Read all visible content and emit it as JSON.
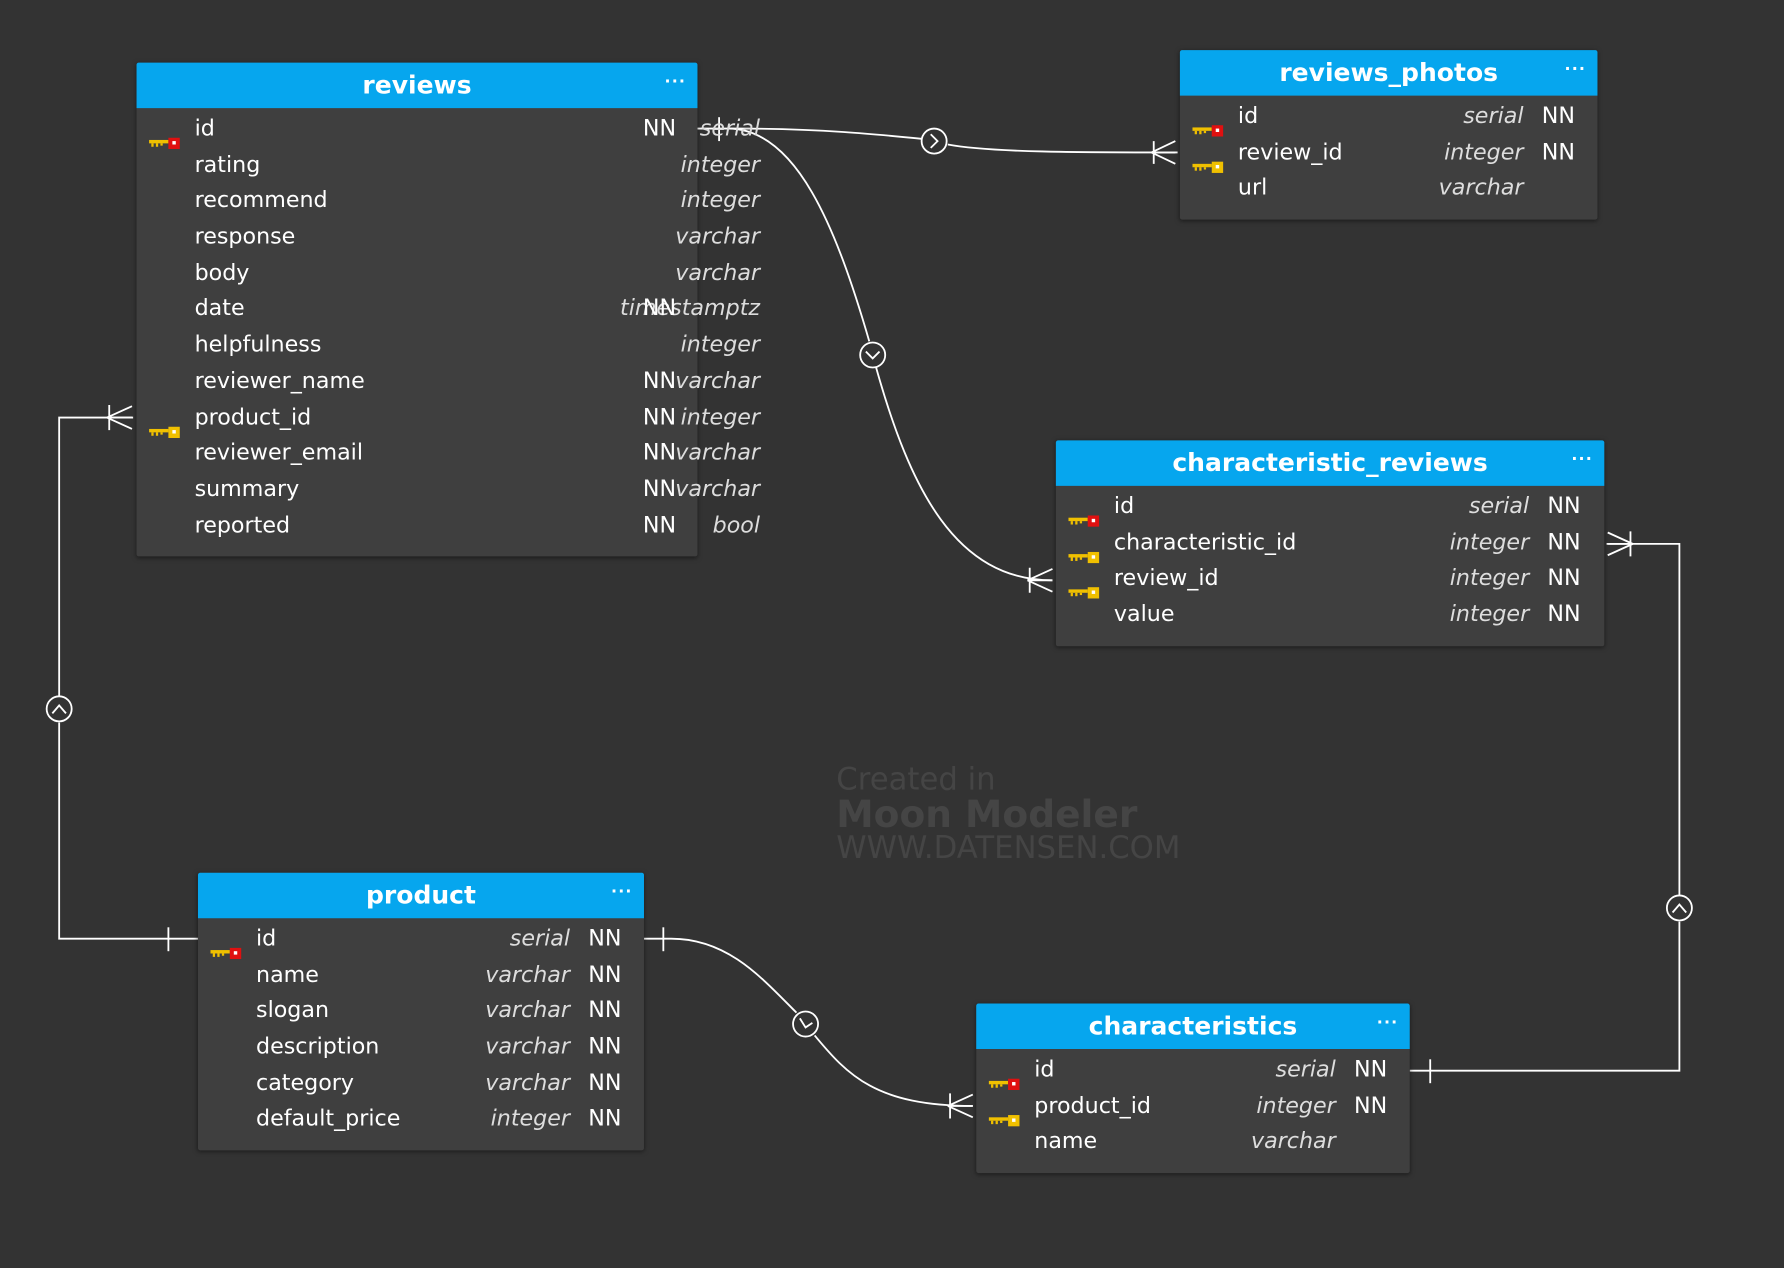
{
  "colors": {
    "background": "#333333",
    "header": "#06a6ee",
    "table_body": "#3f3f3f",
    "primary_key": "#e01010",
    "foreign_key": "#f0c000"
  },
  "watermark": {
    "line1": "Created in",
    "line2": "Moon Modeler",
    "line3": "WWW.DATENSEN.COM"
  },
  "tables": {
    "reviews": {
      "title": "reviews",
      "menu": "···",
      "columns": [
        {
          "name": "id",
          "type": "serial",
          "nn": "NN",
          "key": "pk"
        },
        {
          "name": "rating",
          "type": "integer",
          "nn": "",
          "key": ""
        },
        {
          "name": "recommend",
          "type": "integer",
          "nn": "",
          "key": ""
        },
        {
          "name": "response",
          "type": "varchar",
          "nn": "",
          "key": ""
        },
        {
          "name": "body",
          "type": "varchar",
          "nn": "",
          "key": ""
        },
        {
          "name": "date",
          "type": "timestamptz",
          "nn": "NN",
          "key": ""
        },
        {
          "name": "helpfulness",
          "type": "integer",
          "nn": "",
          "key": ""
        },
        {
          "name": "reviewer_name",
          "type": "varchar",
          "nn": "NN",
          "key": ""
        },
        {
          "name": "product_id",
          "type": "integer",
          "nn": "NN",
          "key": "fk"
        },
        {
          "name": "reviewer_email",
          "type": "varchar",
          "nn": "NN",
          "key": ""
        },
        {
          "name": "summary",
          "type": "varchar",
          "nn": "NN",
          "key": ""
        },
        {
          "name": "reported",
          "type": "bool",
          "nn": "NN",
          "key": ""
        }
      ]
    },
    "reviews_photos": {
      "title": "reviews_photos",
      "menu": "···",
      "columns": [
        {
          "name": "id",
          "type": "serial",
          "nn": "NN",
          "key": "pk"
        },
        {
          "name": "review_id",
          "type": "integer",
          "nn": "NN",
          "key": "fk"
        },
        {
          "name": "url",
          "type": "varchar",
          "nn": "",
          "key": ""
        }
      ]
    },
    "characteristic_reviews": {
      "title": "characteristic_reviews",
      "menu": "···",
      "columns": [
        {
          "name": "id",
          "type": "serial",
          "nn": "NN",
          "key": "pk"
        },
        {
          "name": "characteristic_id",
          "type": "integer",
          "nn": "NN",
          "key": "fk"
        },
        {
          "name": "review_id",
          "type": "integer",
          "nn": "NN",
          "key": "fk"
        },
        {
          "name": "value",
          "type": "integer",
          "nn": "NN",
          "key": ""
        }
      ]
    },
    "product": {
      "title": "product",
      "menu": "···",
      "columns": [
        {
          "name": "id",
          "type": "serial",
          "nn": "NN",
          "key": "pk"
        },
        {
          "name": "name",
          "type": "varchar",
          "nn": "NN",
          "key": ""
        },
        {
          "name": "slogan",
          "type": "varchar",
          "nn": "NN",
          "key": ""
        },
        {
          "name": "description",
          "type": "varchar",
          "nn": "NN",
          "key": ""
        },
        {
          "name": "category",
          "type": "varchar",
          "nn": "NN",
          "key": ""
        },
        {
          "name": "default_price",
          "type": "integer",
          "nn": "NN",
          "key": ""
        }
      ]
    },
    "characteristics": {
      "title": "characteristics",
      "menu": "···",
      "columns": [
        {
          "name": "id",
          "type": "serial",
          "nn": "NN",
          "key": "pk"
        },
        {
          "name": "product_id",
          "type": "integer",
          "nn": "NN",
          "key": "fk"
        },
        {
          "name": "name",
          "type": "varchar",
          "nn": "",
          "key": ""
        }
      ]
    }
  },
  "relationships": [
    {
      "from": "reviews.id",
      "to": "reviews_photos.review_id",
      "cardinality": "one-to-many"
    },
    {
      "from": "reviews.id",
      "to": "characteristic_reviews.review_id",
      "cardinality": "one-to-many"
    },
    {
      "from": "product.id",
      "to": "reviews.product_id",
      "cardinality": "one-to-many"
    },
    {
      "from": "product.id",
      "to": "characteristics.product_id",
      "cardinality": "one-to-many"
    },
    {
      "from": "characteristics.id",
      "to": "characteristic_reviews.characteristic_id",
      "cardinality": "one-to-many"
    }
  ]
}
